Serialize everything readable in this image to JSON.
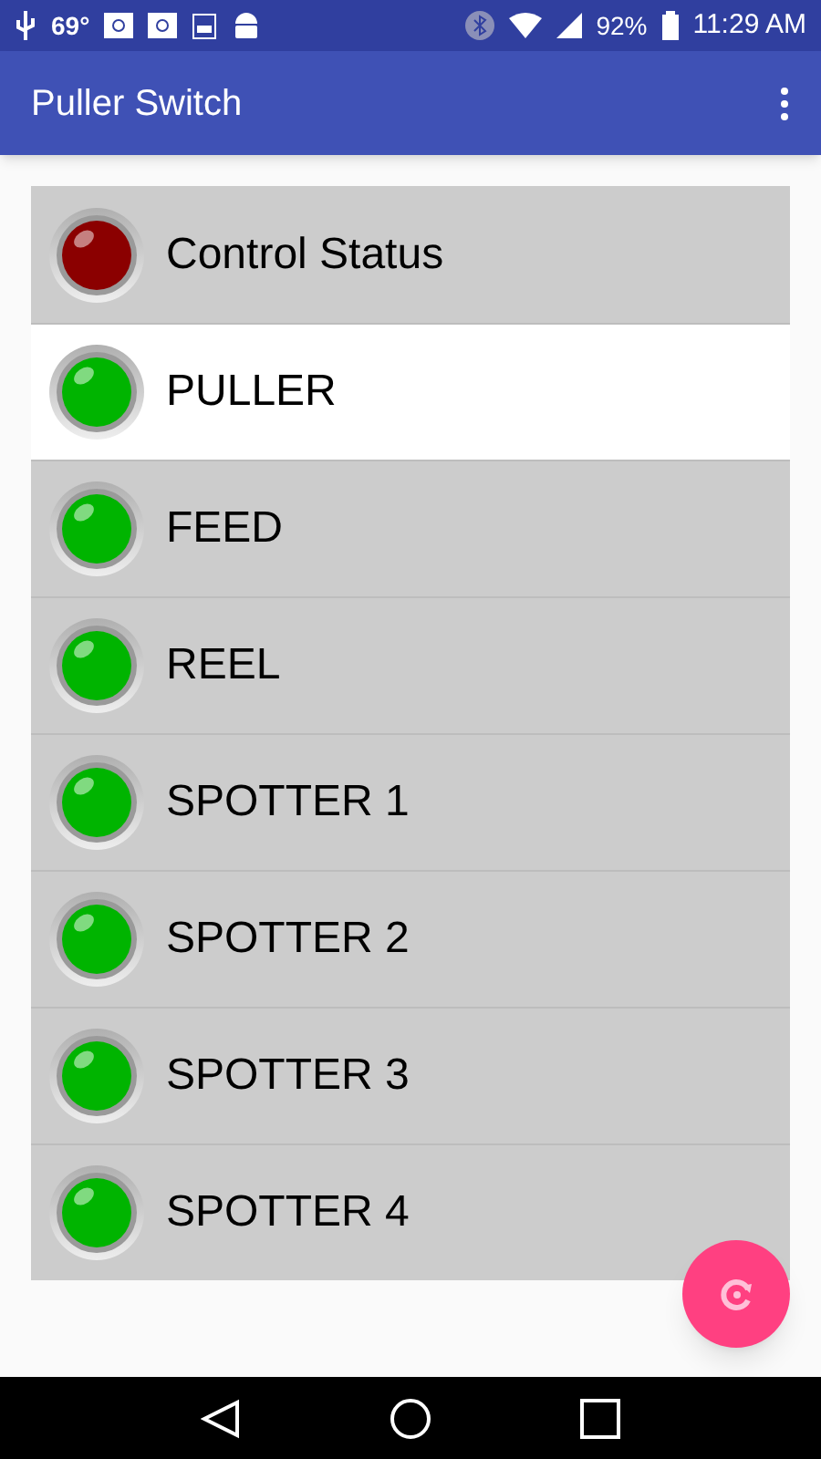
{
  "status_bar": {
    "temperature": "69°",
    "battery": "92%",
    "time": "11:29 AM"
  },
  "app_bar": {
    "title": "Puller Switch"
  },
  "items": [
    {
      "label": "Control Status",
      "color": "#8b0000",
      "selected": false
    },
    {
      "label": "PULLER",
      "color": "#00b400",
      "selected": true
    },
    {
      "label": "FEED",
      "color": "#00b400",
      "selected": false
    },
    {
      "label": "REEL",
      "color": "#00b400",
      "selected": false
    },
    {
      "label": "SPOTTER 1",
      "color": "#00b400",
      "selected": false
    },
    {
      "label": "SPOTTER 2",
      "color": "#00b400",
      "selected": false
    },
    {
      "label": "SPOTTER 3",
      "color": "#00b400",
      "selected": false
    },
    {
      "label": "SPOTTER 4",
      "color": "#00b400",
      "selected": false
    }
  ]
}
